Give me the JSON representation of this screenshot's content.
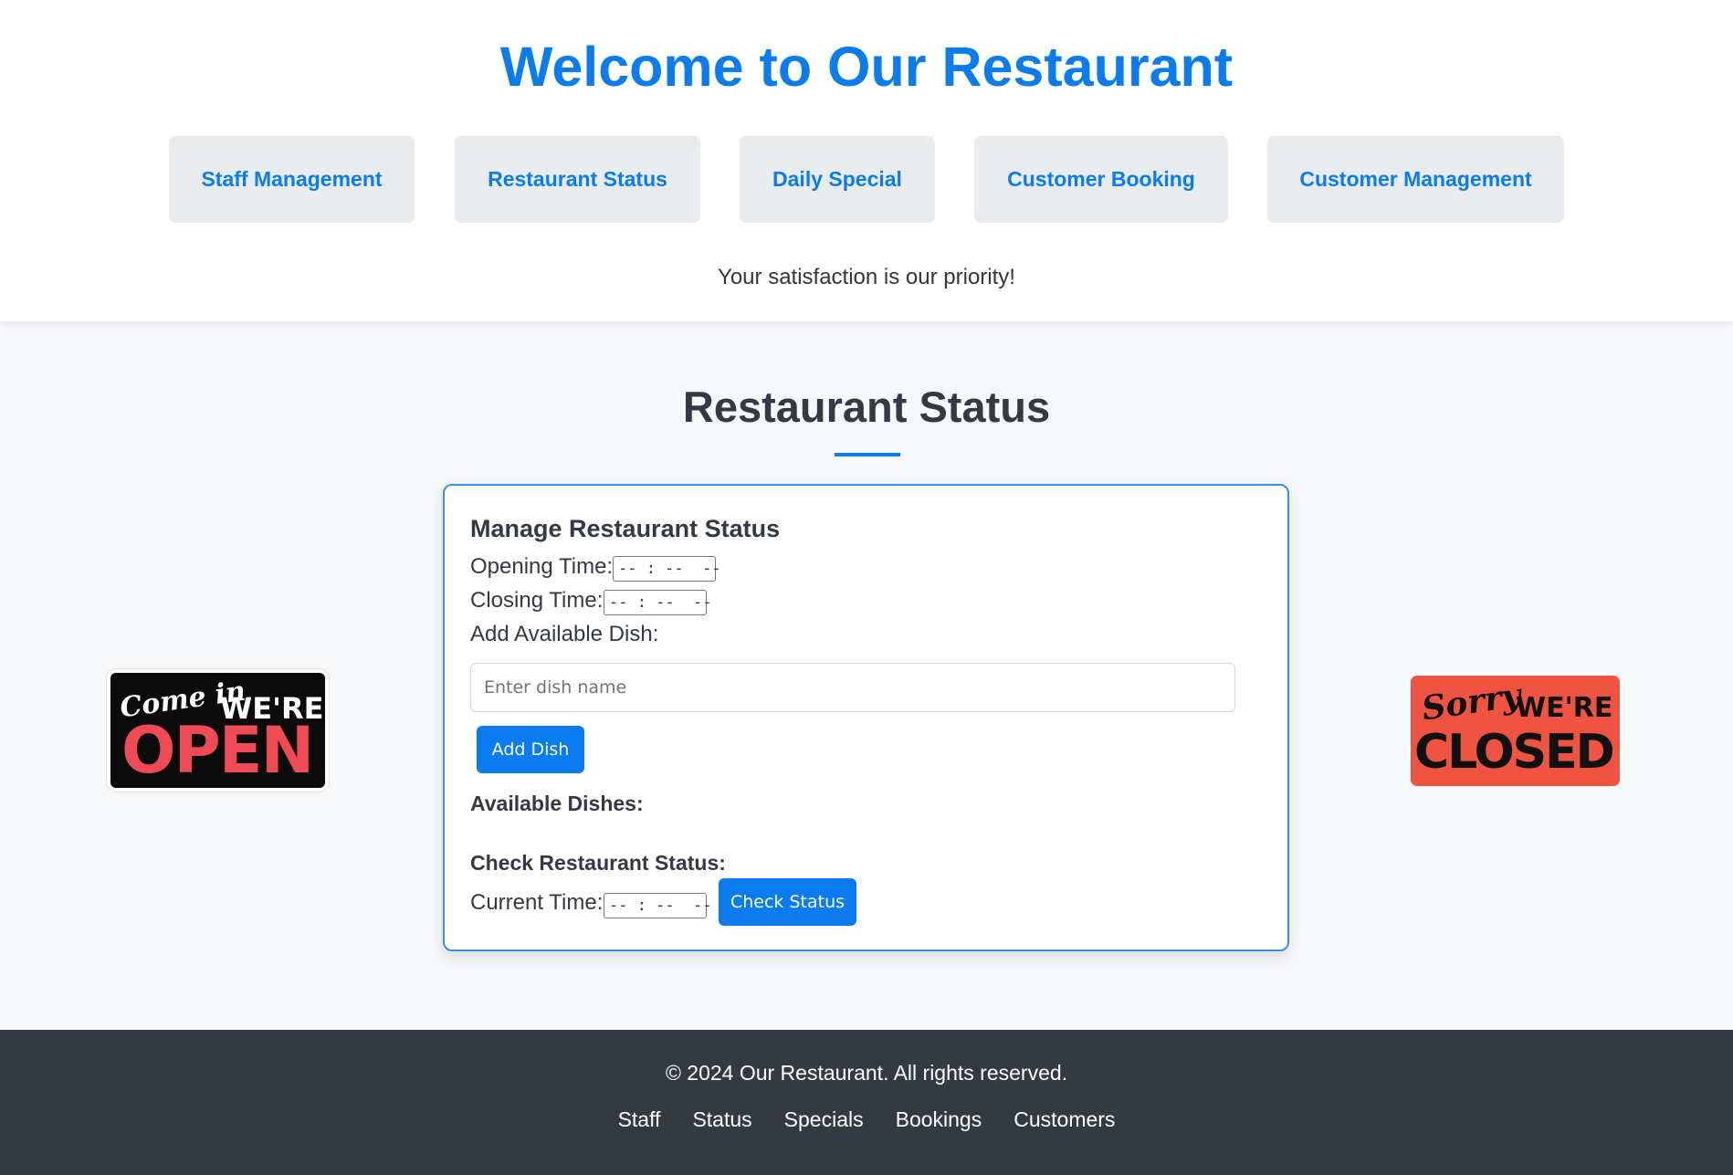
{
  "header": {
    "title": "Welcome to Our Restaurant",
    "nav": [
      {
        "label": "Staff Management"
      },
      {
        "label": "Restaurant Status"
      },
      {
        "label": "Daily Special"
      },
      {
        "label": "Customer Booking"
      },
      {
        "label": "Customer Management"
      }
    ],
    "tagline": "Your satisfaction is our priority!"
  },
  "main": {
    "section_title": "Restaurant Status",
    "card": {
      "title": "Manage Restaurant Status",
      "opening_label": "Opening Time:",
      "opening_value": "-- : --  --",
      "closing_label": "Closing Time:",
      "closing_value": "-- : --  --",
      "add_dish_label": "Add Available Dish:",
      "dish_placeholder": "Enter dish name",
      "add_dish_button": "Add Dish",
      "available_dishes_label": "Available Dishes:",
      "available_dishes": [],
      "check_status_label": "Check Restaurant Status:",
      "current_time_label": "Current Time:",
      "current_time_value": "-- : --  --",
      "check_status_button": "Check Status"
    },
    "signs": {
      "open": {
        "script": "Come in",
        "small": "WE'RE",
        "big": "OPEN"
      },
      "closed": {
        "script": "Sorry",
        "small": "WE'RE",
        "big": "CLOSED"
      }
    }
  },
  "footer": {
    "copyright": "© 2024 Our Restaurant. All rights reserved.",
    "links": [
      {
        "label": "Staff"
      },
      {
        "label": "Status"
      },
      {
        "label": "Specials"
      },
      {
        "label": "Bookings"
      },
      {
        "label": "Customers"
      }
    ]
  },
  "colors": {
    "accent": "#0a7cf0",
    "nav_button_bg": "#e8ecef",
    "footer_bg": "#343a41",
    "closed_sign": "#ef5442",
    "open_sign_text": "#ef4a55"
  }
}
